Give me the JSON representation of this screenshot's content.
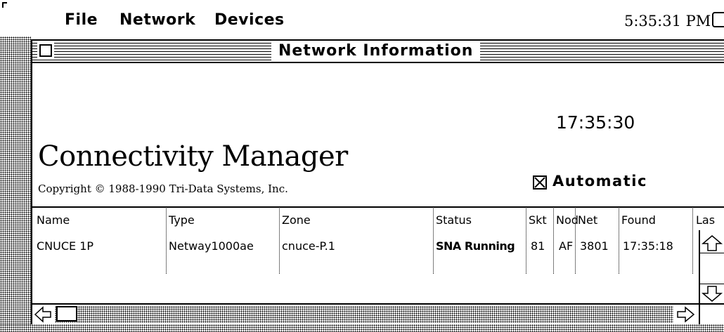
{
  "menubar": {
    "apple": "",
    "menus": [
      "File",
      "Network",
      "Devices"
    ],
    "clock": "5:35:31 PM"
  },
  "window": {
    "title": "Network Information",
    "clock": "17:35:30",
    "app_title": "Connectivity Manager",
    "copyright": "Copyright © 1988-1990 Tri-Data Systems, Inc.",
    "automatic_label": "Automatic",
    "automatic_checked": true
  },
  "table": {
    "columns": [
      "Name",
      "Type",
      "Zone",
      "Status",
      "Skt",
      "Nod",
      "Net",
      "Found",
      "Las"
    ],
    "rows": [
      {
        "name": "CNUCE 1P",
        "type": "Netway1000ae",
        "zone": "cnuce-P.1",
        "status": "SNA Running",
        "skt": "81",
        "node": "AF",
        "net": "3801",
        "found": "17:35:18",
        "last": ""
      }
    ]
  },
  "icons": {
    "close": "close-box-icon",
    "checkbox": "checkbox-checked-icon",
    "scroll_up": "arrow-up-icon",
    "scroll_down": "arrow-down-icon",
    "scroll_left": "arrow-left-icon",
    "scroll_right": "arrow-right-icon",
    "app": "application-icon"
  }
}
